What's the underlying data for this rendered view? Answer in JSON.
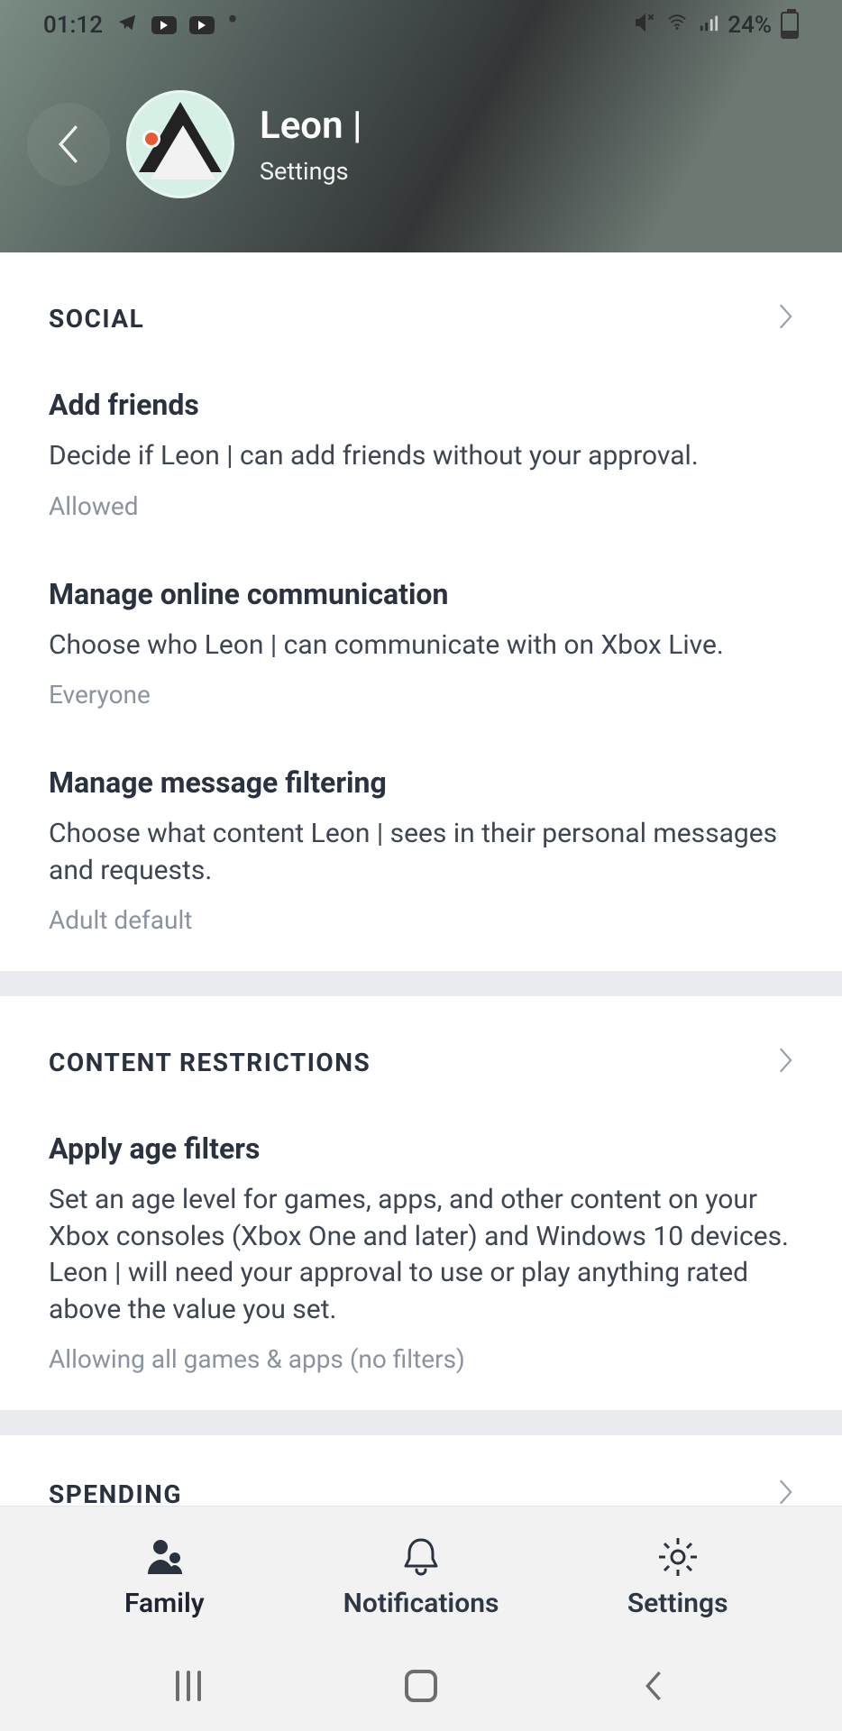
{
  "statusbar": {
    "time": "01:12",
    "battery_text": "24%"
  },
  "header": {
    "name": "Leon |",
    "subtitle": "Settings"
  },
  "sections": {
    "social": {
      "title": "SOCIAL",
      "items": [
        {
          "title": "Add friends",
          "desc": "Decide if Leon | can add friends without your approval.",
          "value": "Allowed"
        },
        {
          "title": "Manage online communication",
          "desc": "Choose who Leon | can communicate with on Xbox Live.",
          "value": "Everyone"
        },
        {
          "title": "Manage message filtering",
          "desc": "Choose what content Leon | sees in their personal messages and requests.",
          "value": "Adult default"
        }
      ]
    },
    "content_restrictions": {
      "title": "CONTENT RESTRICTIONS",
      "items": [
        {
          "title": "Apply age filters",
          "desc": "Set an age level for games, apps, and other content on your Xbox consoles (Xbox One and later) and Windows 10 devices. Leon | will need your approval to use or play anything rated above the value you set.",
          "value": "Allowing all games & apps (no filters)"
        }
      ]
    },
    "spending": {
      "title": "SPENDING"
    }
  },
  "bottom_nav": {
    "family": "Family",
    "notifications": "Notifications",
    "settings": "Settings"
  }
}
